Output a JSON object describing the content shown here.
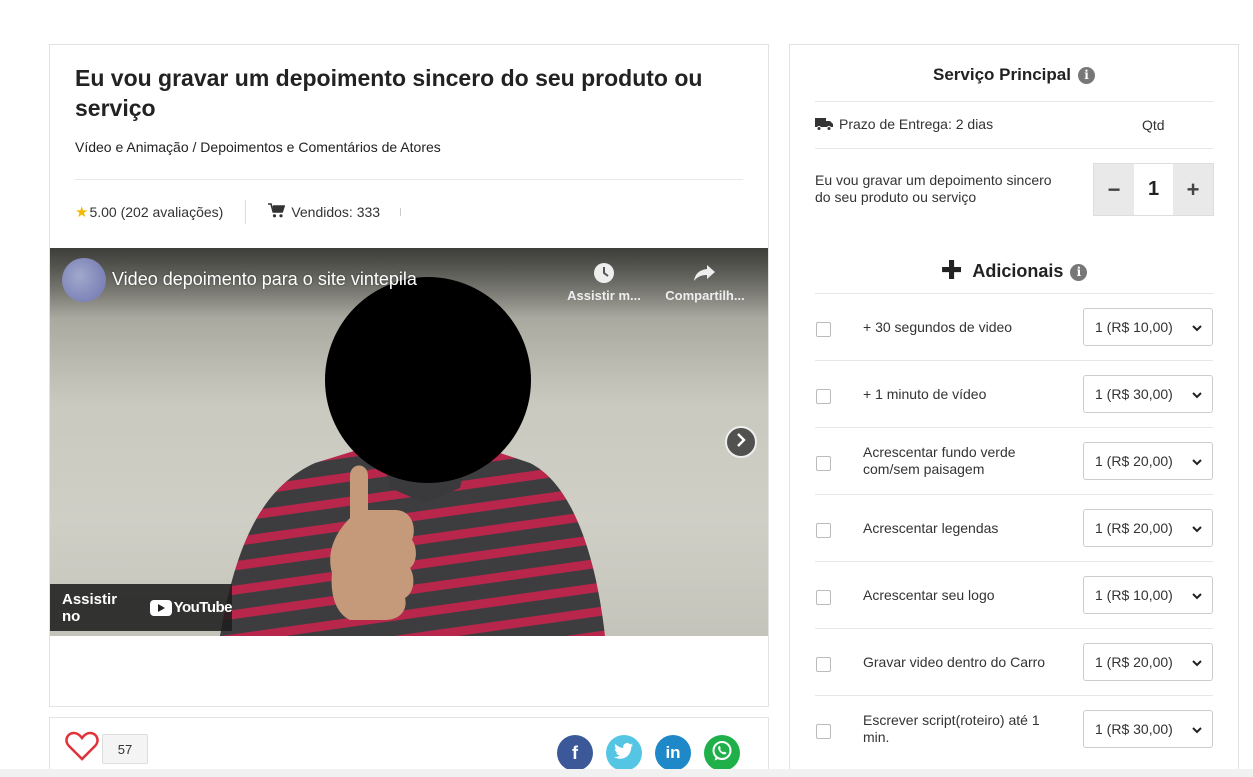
{
  "product": {
    "title": "Eu vou gravar um depoimento sincero do seu produto ou serviço",
    "breadcrumb": "Vídeo e Animação / Depoimentos e Comentários de Atores",
    "rating": "5.00 (202 avaliações)",
    "sold": "Vendidos: 333"
  },
  "video": {
    "title": "Video depoimento para o site vintepila",
    "watch_later": "Assistir m...",
    "share": "Compartilh...",
    "watch_on": "Assistir no",
    "youtube": "YouTube"
  },
  "social": {
    "likes": "57",
    "share_buttons": [
      {
        "name": "facebook",
        "icon": "f",
        "color": "#3b5998"
      },
      {
        "name": "twitter",
        "icon": "twitter-bird",
        "color": "#55c5e4"
      },
      {
        "name": "linkedin",
        "icon": "in",
        "color": "#1e88c9"
      },
      {
        "name": "whatsapp",
        "icon": "whatsapp-phone",
        "color": "#1fb04a"
      }
    ]
  },
  "service": {
    "title": "Serviço Principal",
    "delivery": "Prazo de Entrega: 2 dias",
    "qty_label": "Qtd",
    "description": "Eu vou gravar um depoimento sincero do seu produto ou serviço",
    "quantity": "1",
    "minus": "−",
    "plus": "+"
  },
  "addons": {
    "title": "Adicionais",
    "items": [
      {
        "label": "+ 30 segundos de video",
        "option": "1 (R$ 10,00)"
      },
      {
        "label": "+ 1 minuto de vídeo",
        "option": "1 (R$ 30,00)"
      },
      {
        "label": "Acrescentar fundo verde com/sem paisagem",
        "option": "1 (R$ 20,00)"
      },
      {
        "label": "Acrescentar legendas",
        "option": "1 (R$ 20,00)"
      },
      {
        "label": "Acrescentar seu logo",
        "option": "1 (R$ 10,00)"
      },
      {
        "label": "Gravar video dentro do Carro",
        "option": "1 (R$ 20,00)"
      },
      {
        "label": "Escrever script(roteiro) até 1 min.",
        "option": "1 (R$ 30,00)"
      }
    ]
  }
}
